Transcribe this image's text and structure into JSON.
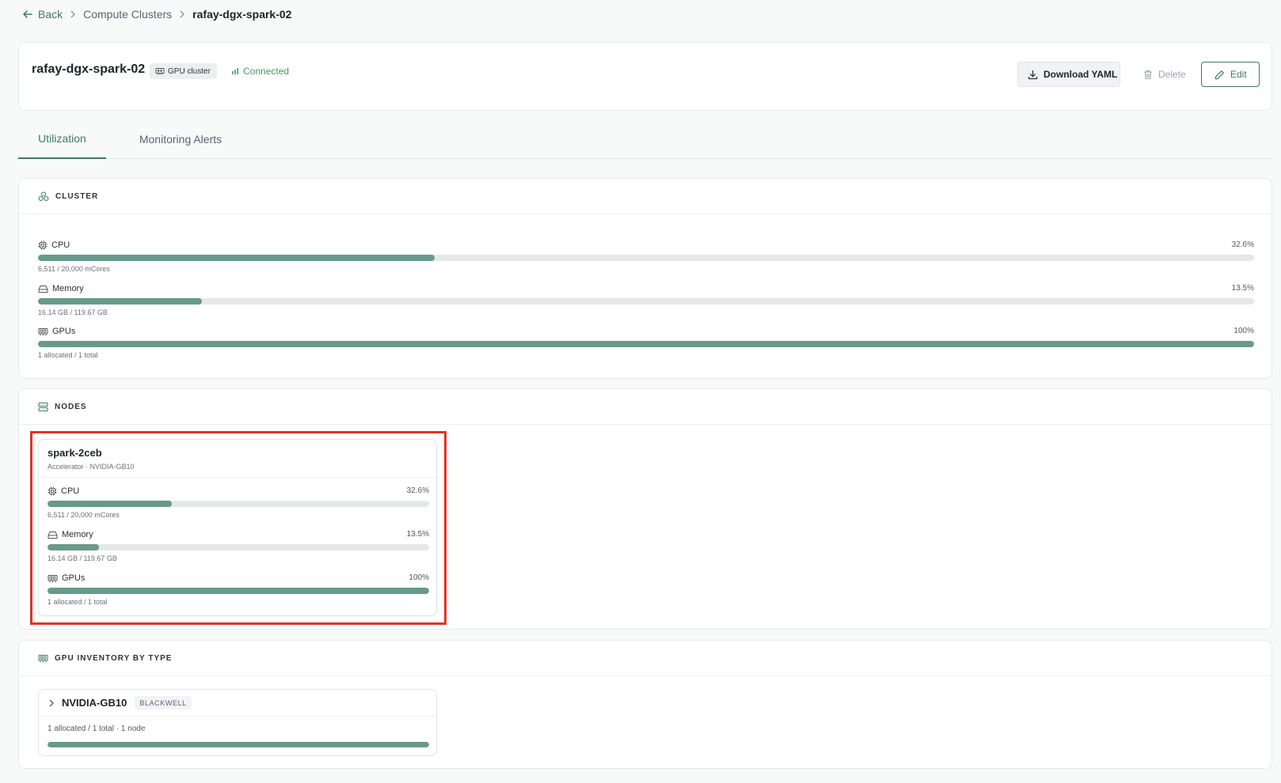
{
  "breadcrumb": {
    "back_label": "Back",
    "parent_label": "Compute Clusters",
    "current_label": "rafay-dgx-spark-02"
  },
  "header": {
    "cluster_name": "rafay-dgx-spark-02",
    "type_badge": "GPU cluster",
    "status": "Connected",
    "download_label": "Download YAML",
    "delete_label": "Delete",
    "edit_label": "Edit"
  },
  "tabs": [
    {
      "label": "Utilization",
      "active": true
    },
    {
      "label": "Monitoring Alerts",
      "active": false
    }
  ],
  "cluster": {
    "heading": "CLUSTER",
    "metrics": [
      {
        "label": "CPU",
        "percent": "32.6%",
        "detail": "6,511 / 20,000 mCores",
        "fill": 32.6,
        "icon": "cpu-icon"
      },
      {
        "label": "Memory",
        "percent": "13.5%",
        "detail": "16.14 GB / 119.67 GB",
        "fill": 13.5,
        "icon": "memory-icon"
      },
      {
        "label": "GPUs",
        "percent": "100%",
        "detail": "1 allocated / 1 total",
        "fill": 100,
        "icon": "gpu-icon"
      }
    ]
  },
  "nodes": {
    "heading": "NODES",
    "items": [
      {
        "name": "spark-2ceb",
        "subtitle": "Accelerator · NVIDIA-GB10",
        "metrics": [
          {
            "label": "CPU",
            "percent": "32.6%",
            "detail": "6,511 / 20,000 mCores",
            "fill": 32.6,
            "icon": "cpu-icon"
          },
          {
            "label": "Memory",
            "percent": "13.5%",
            "detail": "16.14 GB / 119.67 GB",
            "fill": 13.5,
            "icon": "memory-icon"
          },
          {
            "label": "GPUs",
            "percent": "100%",
            "detail": "1 allocated / 1 total",
            "fill": 100,
            "icon": "gpu-icon"
          }
        ]
      }
    ]
  },
  "gpu_inventory": {
    "heading": "GPU INVENTORY BY TYPE",
    "items": [
      {
        "name": "NVIDIA-GB10",
        "badge": "BLACKWELL",
        "stats": "1 allocated / 1 total  ·  1 node",
        "fill": 100
      }
    ]
  },
  "colors": {
    "accent": "#3d7a63",
    "bar_fill": "#689a89",
    "bar_track": "#e3e9e7",
    "status_green": "#3f9b5e",
    "highlight": "#e23224"
  }
}
